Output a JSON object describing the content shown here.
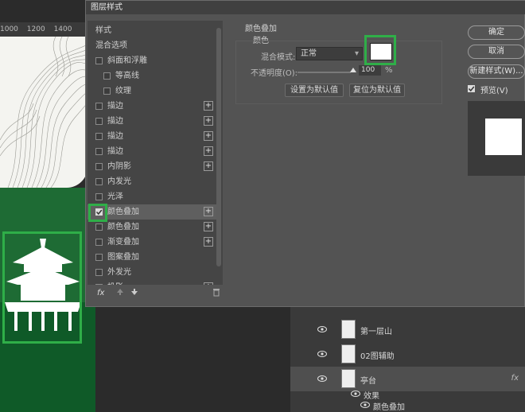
{
  "background": {
    "ruler_marks": [
      "1000",
      "1200",
      "1400"
    ],
    "layers": [
      {
        "name": "第一层山",
        "fx": ""
      },
      {
        "name": "02图辅助",
        "fx": ""
      },
      {
        "name": "亭台",
        "fx": "fx"
      },
      {
        "name": "效果",
        "fx": ""
      },
      {
        "name": "颜色叠加",
        "fx": ""
      }
    ]
  },
  "dialog": {
    "title": "图层样式",
    "styles_header": "样式",
    "blend_options": "混合选项",
    "style_items": [
      {
        "label": "斜面和浮雕",
        "checked": false,
        "plus": false,
        "indent": false
      },
      {
        "label": "等高线",
        "checked": false,
        "plus": false,
        "indent": true
      },
      {
        "label": "纹理",
        "checked": false,
        "plus": false,
        "indent": true
      },
      {
        "label": "描边",
        "checked": false,
        "plus": true,
        "indent": false
      },
      {
        "label": "描边",
        "checked": false,
        "plus": true,
        "indent": false
      },
      {
        "label": "描边",
        "checked": false,
        "plus": true,
        "indent": false
      },
      {
        "label": "描边",
        "checked": false,
        "plus": true,
        "indent": false
      },
      {
        "label": "内阴影",
        "checked": false,
        "plus": true,
        "indent": false
      },
      {
        "label": "内发光",
        "checked": false,
        "plus": false,
        "indent": false
      },
      {
        "label": "光泽",
        "checked": false,
        "plus": false,
        "indent": false
      },
      {
        "label": "颜色叠加",
        "checked": true,
        "plus": true,
        "indent": false
      },
      {
        "label": "颜色叠加",
        "checked": false,
        "plus": true,
        "indent": false
      },
      {
        "label": "渐变叠加",
        "checked": false,
        "plus": true,
        "indent": false
      },
      {
        "label": "图案叠加",
        "checked": false,
        "plus": false,
        "indent": false
      },
      {
        "label": "外发光",
        "checked": false,
        "plus": false,
        "indent": false
      },
      {
        "label": "投影",
        "checked": false,
        "plus": true,
        "indent": false
      }
    ],
    "fx_label": "fx",
    "section_title": "颜色叠加",
    "section_subtitle": "颜色",
    "blend_mode_label": "混合模式:",
    "blend_mode_value": "正常",
    "overlay_color": "#ffffff",
    "opacity_label": "不透明度(O):",
    "opacity_value": "100",
    "opacity_unit": "%",
    "set_default": "设置为默认值",
    "reset_default": "复位为默认值",
    "ok": "确定",
    "cancel": "取消",
    "new_style": "新建样式(W)...",
    "preview_label": "预览(V)",
    "preview_checked": true,
    "highlight_color": "#2fae48"
  }
}
